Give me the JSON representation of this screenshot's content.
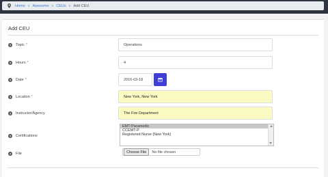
{
  "breadcrumb": {
    "items": [
      "Home",
      "Awesome",
      "CEUs"
    ],
    "current": "Add CEU"
  },
  "panel": {
    "title": "Add CEU"
  },
  "form": {
    "topic": {
      "label": "Topic",
      "value": "Operations"
    },
    "hours": {
      "label": "Hours",
      "value": "4"
    },
    "date": {
      "label": "Date",
      "value": "2016-03-18"
    },
    "location": {
      "label": "Location",
      "value": "New York, New York"
    },
    "instructor": {
      "label": "Instructor/Agency",
      "value": "The Fire Department"
    },
    "certifications": {
      "label": "Certifications",
      "options": [
        "EMT-Paramedic",
        "CCEMT-P",
        "Registered Nurse (New York)"
      ],
      "selected": "EMT-Paramedic"
    },
    "file": {
      "label": "File",
      "button": "Choose File",
      "status": "No file chosen"
    }
  },
  "colors": {
    "accent": "#3f3fd6",
    "highlight": "#fbfbc4",
    "link": "#3a7bd5",
    "required": "#d9534f"
  }
}
